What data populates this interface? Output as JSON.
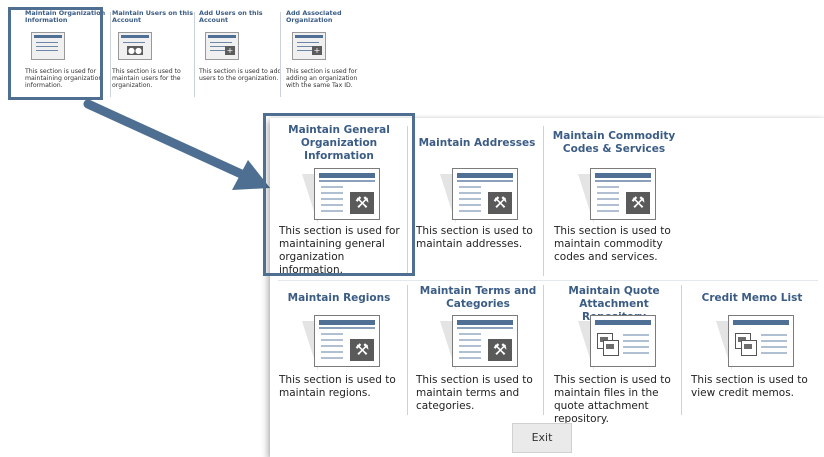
{
  "small_strip": {
    "tiles": [
      {
        "title": "Maintain Organization Information",
        "description": "This section is used for maintaining organization information."
      },
      {
        "title": "Maintain Users on this Account",
        "description": "This section is used to maintain users for the organization."
      },
      {
        "title": "Add Users on this Account",
        "description": "This section is used to add users to the organization."
      },
      {
        "title": "Add Associated Organization",
        "description": "This section is used for adding an organization with the same Tax ID."
      }
    ],
    "icons": {
      "tool": "✕",
      "plus": "+"
    }
  },
  "main": {
    "tiles": [
      {
        "title": "Maintain General Organization Information",
        "description": "This section is used for maintaining general organization information.",
        "icon": "tools-icon"
      },
      {
        "title": "Maintain Addresses",
        "description": "This section is used to maintain addresses.",
        "icon": "tools-icon"
      },
      {
        "title": "Maintain Commodity Codes & Services",
        "description": "This section is used to maintain commodity codes and services.",
        "icon": "tools-icon"
      },
      {
        "title": "Maintain Regions",
        "description": "This section is used to maintain regions.",
        "icon": "tools-icon"
      },
      {
        "title": "Maintain Terms and Categories",
        "description": "This section is used to maintain terms and categories.",
        "icon": "tools-icon"
      },
      {
        "title": "Maintain Quote Attachment Repository",
        "description": "This section is used to maintain files in the quote attachment repository.",
        "icon": "documents-icon"
      },
      {
        "title": "Credit Memo List",
        "description": "This section is used to view credit memos.",
        "icon": "documents-icon"
      }
    ],
    "tool_glyph": "⚒",
    "exit_label": "Exit"
  },
  "colors": {
    "accent": "#4e6f92",
    "title": "#3b5c85",
    "button": "#eaeaea"
  }
}
